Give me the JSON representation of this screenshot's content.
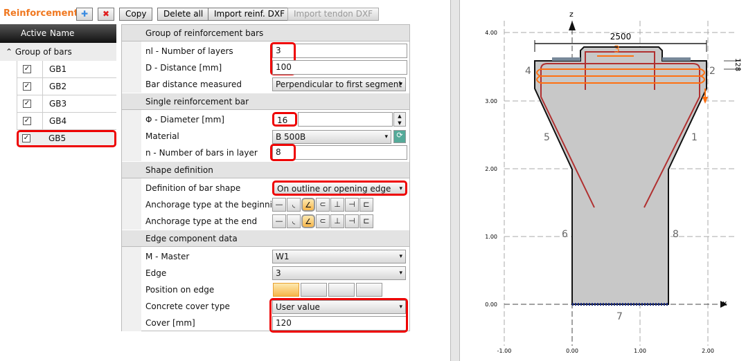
{
  "toolbar": {
    "title": "Reinforcement",
    "add_icon": "plus-icon",
    "delete_icon": "x-icon",
    "copy": "Copy",
    "delete_all": "Delete all",
    "import_reinf": "Import reinf. DXF",
    "import_tendon": "Import tendon DXF"
  },
  "tree": {
    "col_active": "Active",
    "col_name": "Name",
    "group": "Group of bars",
    "items": [
      {
        "name": "GB1",
        "active": true
      },
      {
        "name": "GB2",
        "active": true
      },
      {
        "name": "GB3",
        "active": true
      },
      {
        "name": "GB4",
        "active": true
      },
      {
        "name": "GB5",
        "active": true
      }
    ]
  },
  "props": {
    "sec1": "Group of reinforcement bars",
    "nl_label": "nl - Number of layers",
    "nl": "3",
    "d_label": "D - Distance [mm]",
    "d": "100",
    "measured_label": "Bar distance measured",
    "measured": "Perpendicular to first segment +",
    "sec2": "Single reinforcement bar",
    "dia_label": "Φ - Diameter [mm]",
    "dia": "16",
    "mat_label": "Material",
    "mat": "B 500B",
    "n_label": "n - Number of bars in layer",
    "n": "8",
    "sec3": "Shape definition",
    "shape_label": "Definition of bar shape",
    "shape": "On outline or opening edge",
    "anch_begin_label": "Anchorage type at the beginning",
    "anch_end_label": "Anchorage type at the end",
    "anchor_selected_index": 2,
    "sec4": "Edge component data",
    "master_label": "M - Master",
    "master": "W1",
    "edge_label": "Edge",
    "edge": "3",
    "pos_label": "Position on edge",
    "pos_selected_index": 0,
    "cover_type_label": "Concrete cover type",
    "cover_type": "User value",
    "cover_label": "Cover [mm]",
    "cover": "120"
  },
  "drawing": {
    "axis_z": "z",
    "axis_x": "x",
    "y_ticks": [
      "4.00",
      "3.00",
      "2.00",
      "1.00",
      "0.00"
    ],
    "x_ticks": [
      "-1.00",
      "0.00",
      "1.00",
      "2.00"
    ],
    "dim_width": "2500",
    "dim_side": "128",
    "edges": [
      "1",
      "2",
      "3",
      "4",
      "5",
      "6",
      "7",
      "8"
    ],
    "colors": {
      "concrete": "#c8c8c8",
      "bar": "#b03030",
      "selected": "#ff7010"
    }
  }
}
